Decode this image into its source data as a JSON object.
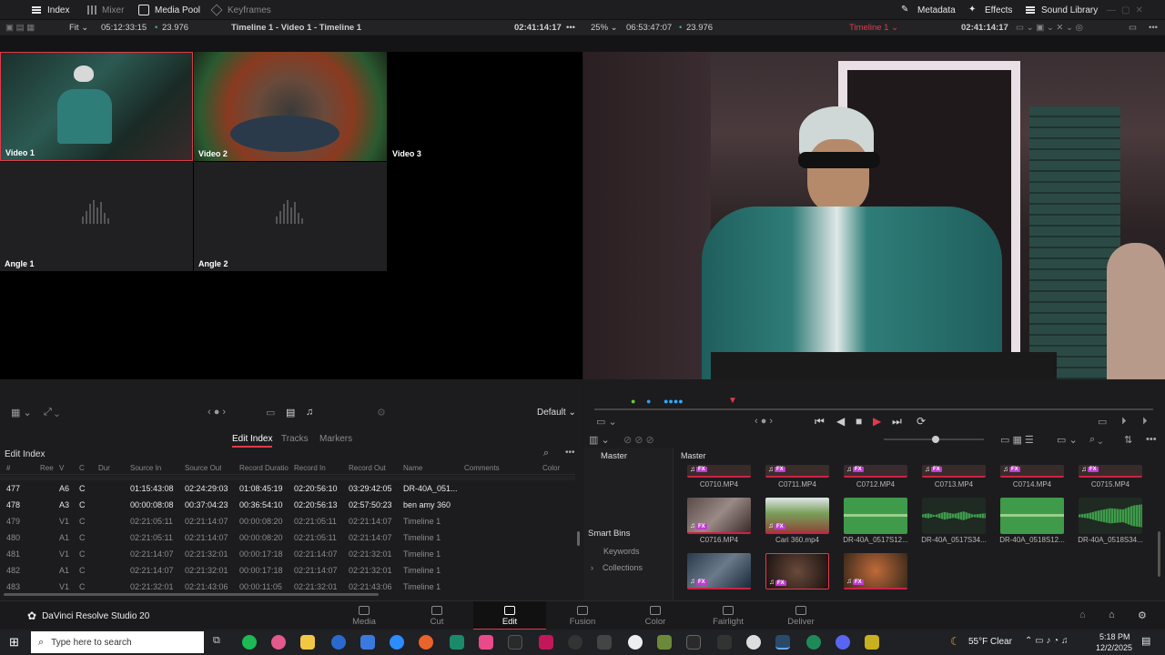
{
  "topbar": {
    "index": "Index",
    "mixer": "Mixer",
    "media_pool": "Media Pool",
    "keyframes": "Keyframes",
    "metadata": "Metadata",
    "effects": "Effects",
    "sound_library": "Sound Library"
  },
  "subbar": {
    "fit": "Fit",
    "source_tc": "05:12:33:15",
    "fps_left": "23.976",
    "timeline_name": "Timeline 1 - Video 1 - Timeline 1",
    "tc_left_end": "02:41:14:17",
    "zoom": "25%",
    "tc_duration": "06:53:47:07",
    "fps_right": "23.976",
    "timeline_select": "Timeline 1",
    "tc_right_end": "02:41:14:17"
  },
  "multicam": {
    "video1": "Video 1",
    "video2": "Video 2",
    "video3": "Video 3",
    "angle1": "Angle 1",
    "angle2": "Angle 2"
  },
  "lower_controls": {
    "default": "Default"
  },
  "index_panel": {
    "tabs": [
      "Edit Index",
      "Tracks",
      "Markers"
    ],
    "title": "Edit Index",
    "columns": [
      "#",
      "Ree",
      "V",
      "C",
      "Dur",
      "Source In",
      "Source Out",
      "Record Duratio",
      "Record In",
      "Record Out",
      "Name",
      "Comments",
      "Color"
    ],
    "rows": [
      {
        "num": "477",
        "v": "A6",
        "c": "C",
        "src_in": "01:15:43:08",
        "src_out": "02:24:29:03",
        "rec_dur": "01:08:45:19",
        "rec_in": "02:20:56:10",
        "rec_out": "03:29:42:05",
        "name": "DR-40A_051...",
        "strong": true
      },
      {
        "num": "478",
        "v": "A3",
        "c": "C",
        "src_in": "00:00:08:08",
        "src_out": "00:37:04:23",
        "rec_dur": "00:36:54:10",
        "rec_in": "02:20:56:13",
        "rec_out": "02:57:50:23",
        "name": "ben amy 360",
        "strong": true
      },
      {
        "num": "479",
        "v": "V1",
        "c": "C",
        "src_in": "02:21:05:11",
        "src_out": "02:21:14:07",
        "rec_dur": "00:00:08:20",
        "rec_in": "02:21:05:11",
        "rec_out": "02:21:14:07",
        "name": "Timeline 1",
        "strong": false
      },
      {
        "num": "480",
        "v": "A1",
        "c": "C",
        "src_in": "02:21:05:11",
        "src_out": "02:21:14:07",
        "rec_dur": "00:00:08:20",
        "rec_in": "02:21:05:11",
        "rec_out": "02:21:14:07",
        "name": "Timeline 1",
        "strong": false
      },
      {
        "num": "481",
        "v": "V1",
        "c": "C",
        "src_in": "02:21:14:07",
        "src_out": "02:21:32:01",
        "rec_dur": "00:00:17:18",
        "rec_in": "02:21:14:07",
        "rec_out": "02:21:32:01",
        "name": "Timeline 1",
        "strong": false
      },
      {
        "num": "482",
        "v": "A1",
        "c": "C",
        "src_in": "02:21:14:07",
        "src_out": "02:21:32:01",
        "rec_dur": "00:00:17:18",
        "rec_in": "02:21:14:07",
        "rec_out": "02:21:32:01",
        "name": "Timeline 1",
        "strong": false
      },
      {
        "num": "483",
        "v": "V1",
        "c": "C",
        "src_in": "02:21:32:01",
        "src_out": "02:21:43:06",
        "rec_dur": "00:00:11:05",
        "rec_in": "02:21:32:01",
        "rec_out": "02:21:43:06",
        "name": "Timeline 1",
        "strong": false
      }
    ]
  },
  "media_pool": {
    "master_left": "Master",
    "master_right": "Master",
    "smart_bins": "Smart Bins",
    "keywords": "Keywords",
    "collections": "Collections",
    "row1": [
      "C0710.MP4",
      "C0711.MP4",
      "C0712.MP4",
      "C0713.MP4",
      "C0714.MP4",
      "C0715.MP4"
    ],
    "row2": [
      "C0716.MP4",
      "Cari 360.mp4",
      "DR-40A_0517S12...",
      "DR-40A_0517S34...",
      "DR-40A_0518S12...",
      "DR-40A_0518S34..."
    ],
    "badge": "FX"
  },
  "pagenav": {
    "app_name": "DaVinci Resolve Studio 20",
    "pages": [
      "Media",
      "Cut",
      "Edit",
      "Fusion",
      "Color",
      "Fairlight",
      "Deliver"
    ]
  },
  "taskbar": {
    "search_placeholder": "Type here to search",
    "weather": "55°F  Clear",
    "time": "5:18 PM",
    "date": "12/2/2025"
  },
  "colors": {
    "accent": "#e4394a",
    "fx_badge": "#c23bd0",
    "audio_green": "#3f9a4a"
  }
}
